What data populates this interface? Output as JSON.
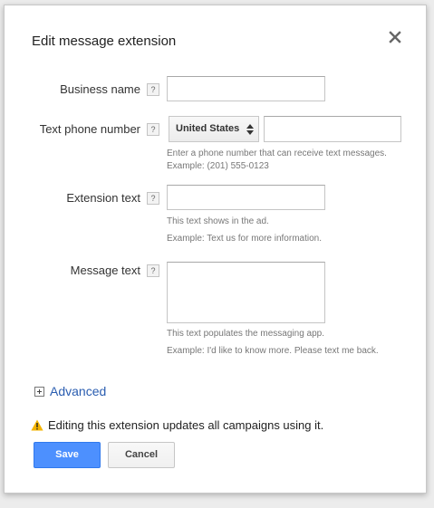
{
  "dialog": {
    "title": "Edit message extension",
    "close_icon": "close-icon"
  },
  "fields": {
    "business_name": {
      "label": "Business name",
      "help": "?",
      "value": ""
    },
    "phone": {
      "label": "Text phone number",
      "help": "?",
      "country_selected": "United States",
      "value": "",
      "hint_line1": "Enter a phone number that can receive text messages.",
      "hint_line2": "Example: (201) 555-0123"
    },
    "extension_text": {
      "label": "Extension text",
      "help": "?",
      "value": "",
      "hint_line1": "This text shows in the ad.",
      "hint_line2": "Example: Text us for more information."
    },
    "message_text": {
      "label": "Message text",
      "help": "?",
      "value": "",
      "hint_line1": "This text populates the messaging app.",
      "hint_line2": "Example: I'd like to know more. Please text me back."
    }
  },
  "advanced": {
    "label": "Advanced",
    "icon": "plus-box-icon"
  },
  "warning": {
    "icon": "warning-icon",
    "text": "Editing this extension updates all campaigns using it.",
    "color": "#f4b400"
  },
  "buttons": {
    "save_label": "Save",
    "cancel_label": "Cancel"
  },
  "colors": {
    "accent": "#4d90fe",
    "link": "#2a5db0"
  }
}
